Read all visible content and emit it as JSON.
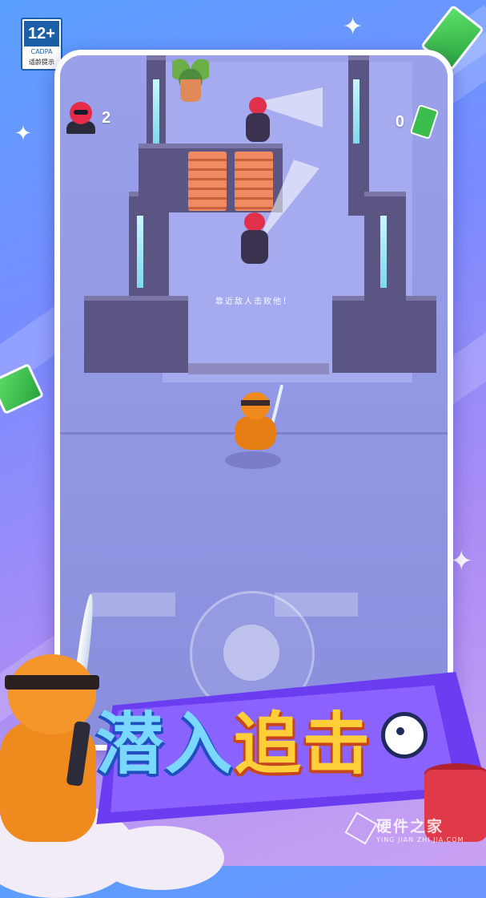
{
  "age_rating": {
    "number": "12+",
    "org": "CADPA",
    "note": "适龄提示"
  },
  "hud": {
    "kills": "2",
    "cash": "0"
  },
  "hint_text": "靠近敌人击败他！",
  "title": {
    "part1": "潜入",
    "part2": "追击"
  },
  "watermark": {
    "main": "硬件之家",
    "sub": "YING JIAN ZHI JIA.COM"
  },
  "colors": {
    "accent_blue": "#7ad8ff",
    "accent_yellow": "#ffcf3a",
    "enemy_red": "#e0304a",
    "player_orange": "#f08a1c",
    "cash_green": "#3bbd4d"
  },
  "icons": [
    "kill-count-icon",
    "cash-icon",
    "target-icon",
    "joystick"
  ]
}
